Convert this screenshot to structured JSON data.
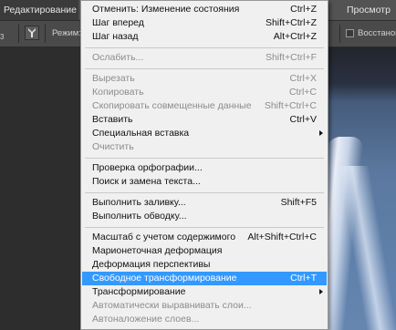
{
  "menubar": {
    "edit_label": "Редактирование",
    "view_label": "Просмотр"
  },
  "options": {
    "size_fragment": "3",
    "mode_label": "Режим:",
    "restore_label": "Восстанови"
  },
  "menu": {
    "items": [
      {
        "label": "Отменить: Изменение состояния",
        "shortcut": "Ctrl+Z",
        "disabled": false
      },
      {
        "label": "Шаг вперед",
        "shortcut": "Shift+Ctrl+Z",
        "disabled": false
      },
      {
        "label": "Шаг назад",
        "shortcut": "Alt+Ctrl+Z",
        "disabled": false
      },
      {
        "label": "Ослабить...",
        "shortcut": "Shift+Ctrl+F",
        "disabled": true
      },
      {
        "label": "Вырезать",
        "shortcut": "Ctrl+X",
        "disabled": true
      },
      {
        "label": "Копировать",
        "shortcut": "Ctrl+C",
        "disabled": true
      },
      {
        "label": "Скопировать совмещенные данные",
        "shortcut": "Shift+Ctrl+C",
        "disabled": true
      },
      {
        "label": "Вставить",
        "shortcut": "Ctrl+V",
        "disabled": false
      },
      {
        "label": "Специальная вставка",
        "shortcut": "",
        "disabled": false,
        "submenu": true
      },
      {
        "label": "Очистить",
        "shortcut": "",
        "disabled": true
      },
      {
        "label": "Проверка орфографии...",
        "shortcut": "",
        "disabled": false
      },
      {
        "label": "Поиск и замена текста...",
        "shortcut": "",
        "disabled": false
      },
      {
        "label": "Выполнить заливку...",
        "shortcut": "Shift+F5",
        "disabled": false
      },
      {
        "label": "Выполнить обводку...",
        "shortcut": "",
        "disabled": false
      },
      {
        "label": "Масштаб с учетом содержимого",
        "shortcut": "Alt+Shift+Ctrl+C",
        "disabled": false
      },
      {
        "label": "Марионеточная деформация",
        "shortcut": "",
        "disabled": false
      },
      {
        "label": "Деформация перспективы",
        "shortcut": "",
        "disabled": false
      },
      {
        "label": "Свободное трансформирование",
        "shortcut": "Ctrl+T",
        "disabled": false,
        "highlighted": true
      },
      {
        "label": "Трансформирование",
        "shortcut": "",
        "disabled": false,
        "submenu": true
      },
      {
        "label": "Автоматически выравнивать слои...",
        "shortcut": "",
        "disabled": true
      },
      {
        "label": "Автоналожение слоев...",
        "shortcut": "",
        "disabled": true
      }
    ]
  }
}
